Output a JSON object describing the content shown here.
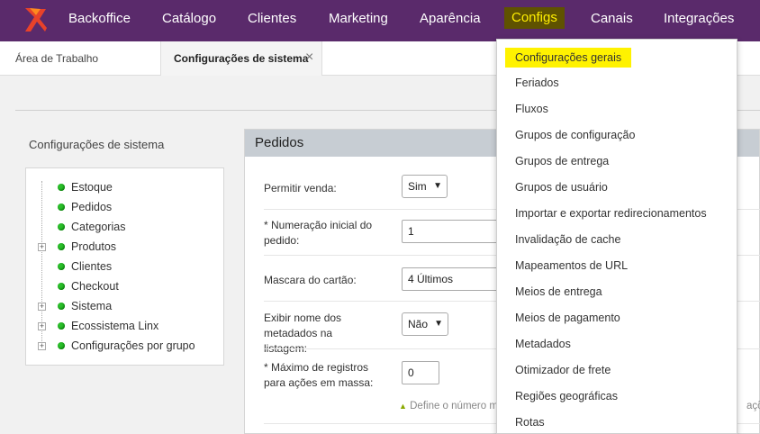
{
  "nav": {
    "items": [
      "Backoffice",
      "Catálogo",
      "Clientes",
      "Marketing",
      "Aparência",
      "Configs",
      "Canais",
      "Integrações"
    ],
    "active": "Configs"
  },
  "tabs": {
    "home": "Área de Trabalho",
    "current": "Configurações de sistema",
    "close_icon": "×"
  },
  "sidebar": {
    "title": "Configurações de sistema",
    "tree": [
      {
        "label": "Estoque",
        "expandable": false
      },
      {
        "label": "Pedidos",
        "expandable": false,
        "selected": true
      },
      {
        "label": "Categorias",
        "expandable": false
      },
      {
        "label": "Produtos",
        "expandable": true
      },
      {
        "label": "Clientes",
        "expandable": false
      },
      {
        "label": "Checkout",
        "expandable": false
      },
      {
        "label": "Sistema",
        "expandable": true
      },
      {
        "label": "Ecossistema Linx",
        "expandable": true
      },
      {
        "label": "Configurações por grupo",
        "expandable": true
      }
    ]
  },
  "panel": {
    "title": "Pedidos",
    "fields": {
      "permitir_venda": {
        "label": "Permitir venda:",
        "value": "Sim"
      },
      "numeracao": {
        "label": "* Numeração inicial do pedido:",
        "value": "1"
      },
      "mascara": {
        "label": "Mascara do cartão:",
        "value": "4 Últimos"
      },
      "exibir_nome": {
        "label": "Exibir nome dos metadados na listagem:",
        "value": "Não"
      },
      "maximo": {
        "label": "* Máximo de registros para ações em massa:",
        "value": "0"
      }
    },
    "hint": "Define o número m",
    "hint_right": "ações"
  },
  "dropdown": {
    "items": [
      "Configurações gerais",
      "Feriados",
      "Fluxos",
      "Grupos de configuração",
      "Grupos de entrega",
      "Grupos de usuário",
      "Importar e exportar redirecionamentos",
      "Invalidação de cache",
      "Mapeamentos de URL",
      "Meios de entrega",
      "Meios de pagamento",
      "Metadados",
      "Otimizador de frete",
      "Regiões geográficas",
      "Rotas"
    ],
    "highlighted": "Configurações gerais"
  },
  "colors": {
    "nav_bg": "#5a2a6b",
    "highlight": "#fff200",
    "status_dot": "#2bc02b"
  }
}
